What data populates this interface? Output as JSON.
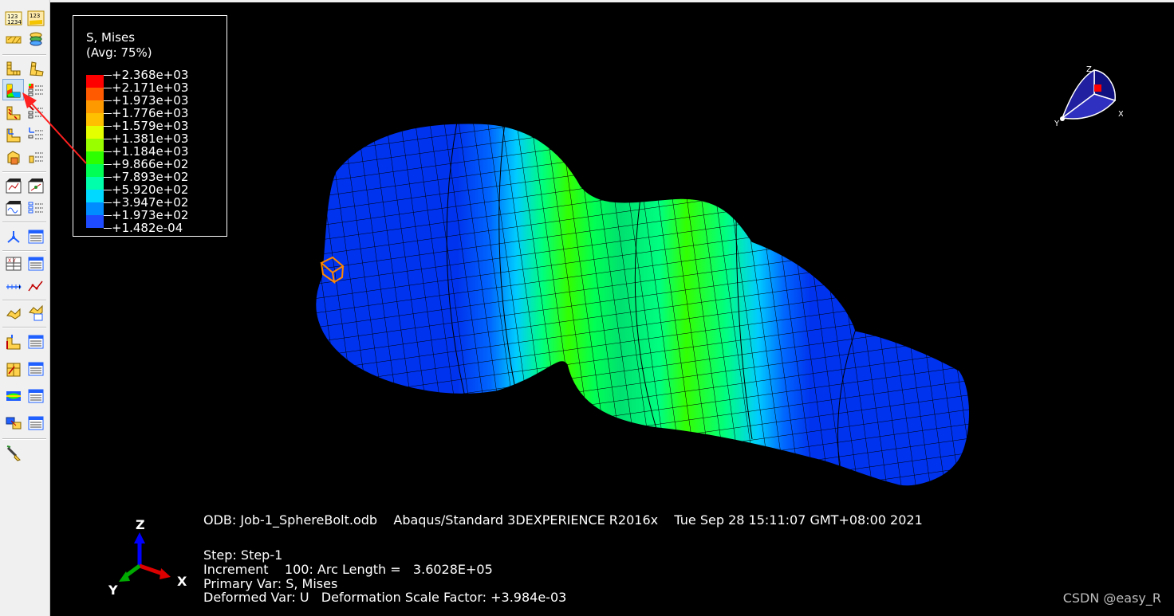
{
  "legend": {
    "title": "S, Mises",
    "subtitle": "(Avg: 75%)",
    "entries": [
      {
        "value": "+2.368e+03",
        "color": "#ff0000"
      },
      {
        "value": "+2.171e+03",
        "color": "#ff5a00"
      },
      {
        "value": "+1.973e+03",
        "color": "#ff9900"
      },
      {
        "value": "+1.776e+03",
        "color": "#ffc000"
      },
      {
        "value": "+1.579e+03",
        "color": "#e6ff00"
      },
      {
        "value": "+1.381e+03",
        "color": "#99ff00"
      },
      {
        "value": "+1.184e+03",
        "color": "#2dff00"
      },
      {
        "value": "+9.866e+02",
        "color": "#00ff55"
      },
      {
        "value": "+7.893e+02",
        "color": "#00ffaa"
      },
      {
        "value": "+5.920e+02",
        "color": "#00d9ff"
      },
      {
        "value": "+3.947e+02",
        "color": "#008cff"
      },
      {
        "value": "+1.973e+02",
        "color": "#1e4bff"
      },
      {
        "value": "+1.482e-04",
        "color": "#0000ff"
      }
    ]
  },
  "info": {
    "odb_line": "ODB: Job-1_SphereBolt.odb    Abaqus/Standard 3DEXPERIENCE R2016x    Tue Sep 28 15:11:07 GMT+08:00 2021",
    "step_line": "Step: Step-1",
    "increment_line": "Increment    100: Arc Length =   3.6028E+05",
    "primary_var_line": "Primary Var: S, Mises",
    "deformed_var_line": "Deformed Var: U   Deformation Scale Factor: +3.984e-03"
  },
  "triad": {
    "x": "X",
    "y": "Y",
    "z": "Z"
  },
  "view_cube": {
    "x": "X",
    "y": "Y",
    "z": "Z"
  },
  "watermark": "CSDN @easy_R",
  "toolbar": {
    "icons": [
      [
        "undeformed-numbered-icon",
        "deformed-numbered-icon"
      ],
      [
        "scale-icon",
        "layers-icon"
      ],
      [
        "undeformed-shape-icon",
        "deformed-shape-icon"
      ],
      [
        "contour-plot-icon",
        "contour-options-icon"
      ],
      [
        "symbol-plot-icon",
        "symbol-options-icon"
      ],
      [
        "material-orientation-icon",
        "orientation-options-icon"
      ],
      [
        "allow-multiple-plot-icon",
        "superimpose-options-icon"
      ],
      [
        "animate-time-history-icon",
        "animate-scale-factor-icon"
      ],
      [
        "animate-harmonic-icon",
        "animation-options-icon"
      ],
      [
        "view-cut-icon",
        "view-cut-manager-icon"
      ],
      [
        "xy-data-create-icon",
        "xy-data-manager-icon"
      ],
      [
        "path-create-icon",
        "xy-plot-icon"
      ],
      [
        "display-group-icon",
        "display-group-manager-icon"
      ],
      [
        "free-body-icon",
        "free-body-manager-icon"
      ],
      [
        "stream-icon",
        "stream-manager-icon"
      ],
      [
        "spectrum-icon",
        "spectrum-manager-icon"
      ],
      [
        "ply-stack-icon",
        "ply-stack-manager-icon"
      ],
      [
        "paint-brush-icon"
      ]
    ]
  }
}
